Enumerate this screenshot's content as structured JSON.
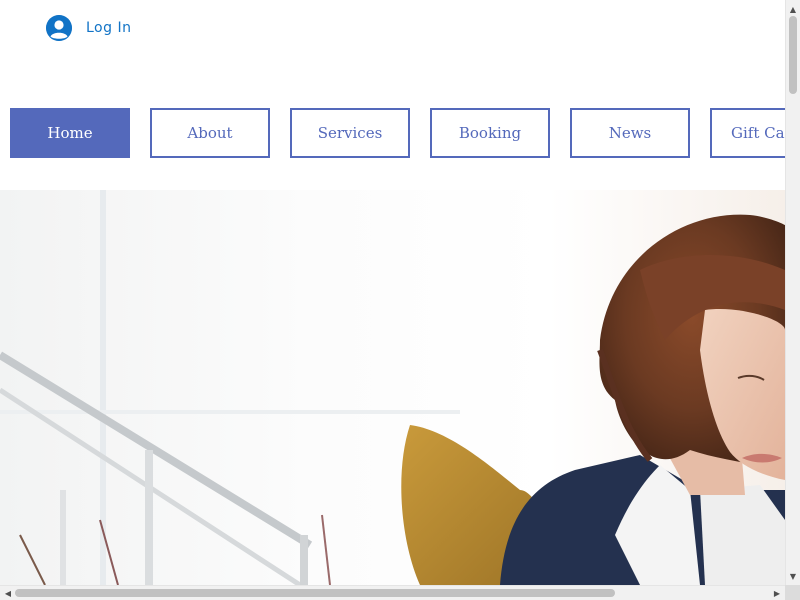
{
  "header": {
    "login": {
      "label": "Log In",
      "icon": "user-avatar-icon"
    }
  },
  "nav": {
    "items": [
      {
        "label": "Home",
        "active": true
      },
      {
        "label": "About",
        "active": false
      },
      {
        "label": "Services",
        "active": false
      },
      {
        "label": "Booking",
        "active": false
      },
      {
        "label": "News",
        "active": false
      },
      {
        "label": "Gift Cards",
        "active": false
      }
    ]
  },
  "hero": {
    "image": "woman-working-at-desk-photo"
  },
  "scrollbars": {
    "vertical_icons": [
      "arrow-up-icon",
      "arrow-down-icon"
    ],
    "horizontal_icons": [
      "arrow-left-icon",
      "arrow-right-icon"
    ]
  },
  "colors": {
    "accent": "#5469bb",
    "login_blue": "#1173c6",
    "background": "#ffffff"
  }
}
